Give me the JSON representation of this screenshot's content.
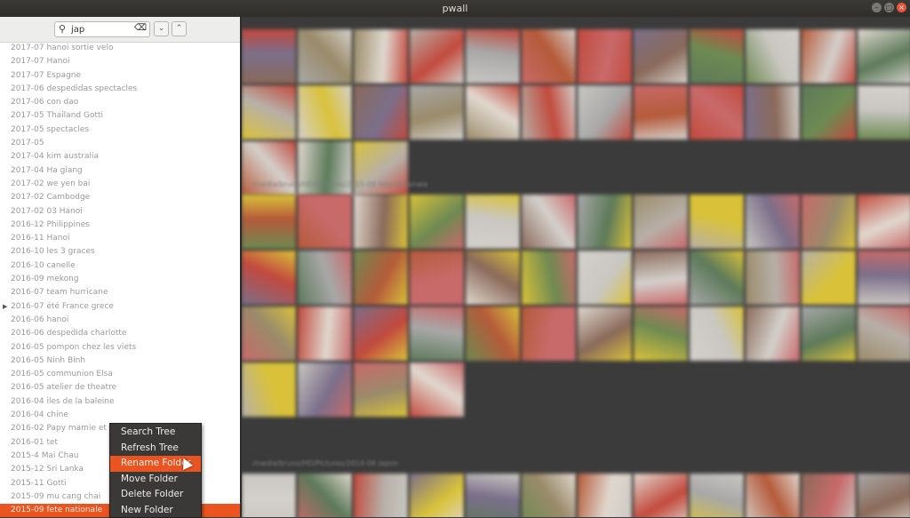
{
  "window": {
    "title": "pwall"
  },
  "search": {
    "value": "jap"
  },
  "tree": [
    {
      "label": "2017-07 hanoi sortie velo"
    },
    {
      "label": "2017-07 Hanoi"
    },
    {
      "label": "2017-07 Espagne"
    },
    {
      "label": "2017-06 despedidas spectacles"
    },
    {
      "label": "2017-06 con dao"
    },
    {
      "label": "2017-05 Thailand Gotti"
    },
    {
      "label": "2017-05 spectacles"
    },
    {
      "label": "2017-05"
    },
    {
      "label": "2017-04 kim australia"
    },
    {
      "label": "2017-04 Ha giang"
    },
    {
      "label": "2017-02 we yen bai"
    },
    {
      "label": "2017-02 Cambodge"
    },
    {
      "label": "2017-02 03 Hanoi"
    },
    {
      "label": "2016-12 Philippines"
    },
    {
      "label": "2016-11 Hanoi"
    },
    {
      "label": "2016-10 les 3 graces"
    },
    {
      "label": "2016-10 canelle"
    },
    {
      "label": "2016-09 mekong"
    },
    {
      "label": "2016-07 team hurricane"
    },
    {
      "label": "2016-07 été France grece",
      "expandable": true
    },
    {
      "label": "2016-06 hanoi"
    },
    {
      "label": "2016-06 despedida charlotte"
    },
    {
      "label": "2016-05 pompon chez les viets"
    },
    {
      "label": "2016-05 Ninh Binh"
    },
    {
      "label": "2016-05 communion Elsa"
    },
    {
      "label": "2016-05 atelier de theatre"
    },
    {
      "label": "2016-04 iles de la baleine"
    },
    {
      "label": "2016-04 chine"
    },
    {
      "label": "2016-02 Papy mamie et lu"
    },
    {
      "label": "2016-01 tet"
    },
    {
      "label": "2015-4 Mai Chau"
    },
    {
      "label": "2015-12 Sri Lanka"
    },
    {
      "label": "2015-11 Gotti"
    },
    {
      "label": "2015-09 mu cang chai"
    },
    {
      "label": "2015-09 fete nationale",
      "selected": true
    }
  ],
  "context_menu": [
    {
      "label": "Search Tree"
    },
    {
      "label": "Refresh Tree"
    },
    {
      "label": "Rename Folder",
      "highlighted": true
    },
    {
      "label": "Move Folder"
    },
    {
      "label": "Delete Folder"
    },
    {
      "label": "New Folder"
    }
  ],
  "sections": [
    {
      "path": "",
      "count": 27
    },
    {
      "path": "/media/bruno/HD/Pictures/2015-09 fete nationale",
      "count": 40
    },
    {
      "path": "/media/bruno/HD/Pictures/2014-06 japon",
      "count": 12
    }
  ],
  "colors": {
    "accent": "#e95420",
    "menu_bg": "#3a3938",
    "panel_bg": "#3b3b3b"
  }
}
